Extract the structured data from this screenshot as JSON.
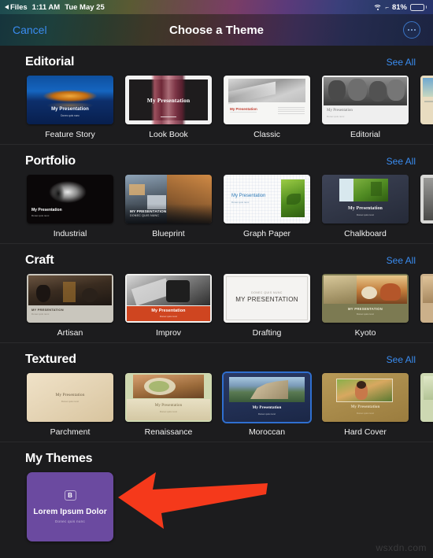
{
  "status_bar": {
    "back_app": "Files",
    "time": "1:11 AM",
    "date": "Tue May 25",
    "battery_percent": "81%",
    "wifi_icon": "wifi-icon",
    "location_icon": "location-arrow-icon",
    "battery_icon": "battery-icon",
    "battery_level": 81
  },
  "nav": {
    "cancel_label": "Cancel",
    "title": "Choose a Theme",
    "more_icon": "ellipsis-circle-icon"
  },
  "sections": [
    {
      "title": "Editorial",
      "see_all": "See All",
      "themes": [
        {
          "name": "Feature Story",
          "selected": false
        },
        {
          "name": "Look Book",
          "selected": false
        },
        {
          "name": "Classic",
          "selected": false
        },
        {
          "name": "Editorial",
          "selected": false
        },
        {
          "name": "",
          "selected": false
        }
      ]
    },
    {
      "title": "Portfolio",
      "see_all": "See All",
      "themes": [
        {
          "name": "Industrial",
          "selected": false
        },
        {
          "name": "Blueprint",
          "selected": false
        },
        {
          "name": "Graph Paper",
          "selected": false
        },
        {
          "name": "Chalkboard",
          "selected": false
        },
        {
          "name": "",
          "selected": false
        }
      ]
    },
    {
      "title": "Craft",
      "see_all": "See All",
      "themes": [
        {
          "name": "Artisan",
          "selected": false
        },
        {
          "name": "Improv",
          "selected": false
        },
        {
          "name": "Drafting",
          "selected": false
        },
        {
          "name": "Kyoto",
          "selected": false
        },
        {
          "name": "",
          "selected": false
        }
      ]
    },
    {
      "title": "Textured",
      "see_all": "See All",
      "themes": [
        {
          "name": "Parchment",
          "selected": false
        },
        {
          "name": "Renaissance",
          "selected": false
        },
        {
          "name": "Moroccan",
          "selected": true
        },
        {
          "name": "Hard Cover",
          "selected": false
        },
        {
          "name": "",
          "selected": false
        }
      ]
    }
  ],
  "my_themes": {
    "title": "My Themes",
    "card": {
      "badge": "B",
      "title": "Lorem Ipsum Dolor",
      "subtitle": "Donec quis nunc"
    }
  },
  "thumbnail_text": {
    "my_presentation": "My Presentation",
    "my_presentation_caps": "MY PRESENTATION",
    "donec_quis_nunc": "DONEC QUIS NUNC",
    "subtitle_small": "Donec quis nunc"
  },
  "annotation": {
    "arrow_color": "#F5391B",
    "arrow_direction": "left",
    "points_at": "Lorem Ipsum Dolor"
  },
  "watermark": "wsxdn.com",
  "colors": {
    "background": "#1c1c1e",
    "accent_blue": "#3a8cf0",
    "my_theme_purple": "#6b4aa0",
    "selected_border": "#2f6fd0"
  }
}
